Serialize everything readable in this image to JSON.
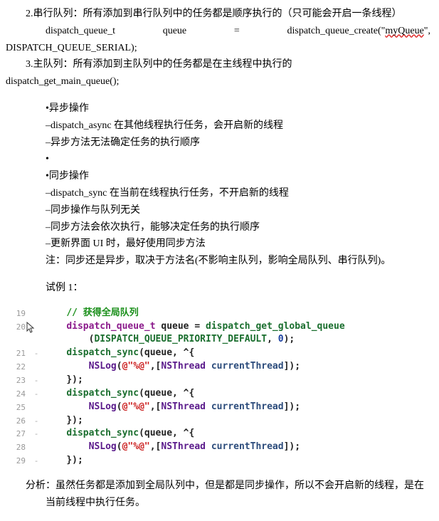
{
  "intro": {
    "item2_label": "2.串行队列：所有添加到串行队列中的任务都是顺序执行的（只可能会开启一条线程）",
    "item2_code_left": "dispatch_queue_t",
    "item2_code_mid": "queue",
    "item2_code_eq": "=",
    "item2_code_right_a": "dispatch_queue_create(\"",
    "item2_code_right_b": "myQueue",
    "item2_code_right_c": "\",",
    "item2_code_line2": "DISPATCH_QUEUE_SERIAL);",
    "item3_label": "3.主队列：所有添加到主队列中的任务都是在主线程中执行的",
    "item3_code": "dispatch_get_main_queue();"
  },
  "bullets": {
    "b1": "•异步操作",
    "b2": "–dispatch_async 在其他线程执行任务，会开启新的线程",
    "b3": "–异步方法无法确定任务的执行顺序",
    "b4": "•",
    "b5": "•同步操作",
    "b6": "–dispatch_sync 在当前在线程执行任务，不开启新的线程",
    "b7": "–同步操作与队列无关",
    "b8": "–同步方法会依次执行，能够决定任务的执行顺序",
    "b9": "–更新界面 UI 时，最好使用同步方法",
    "note": "注：同步还是异步，取决于方法名(不影响主队列，影响全局队列、串行队列)。"
  },
  "example_label": "试例 1：",
  "code": {
    "lines": [
      {
        "n": "19",
        "m": "",
        "indent": "    ",
        "parts": [
          {
            "cls": "tok-comment",
            "t": "// 获得全局队列"
          }
        ]
      },
      {
        "n": "20",
        "m": "",
        "indent": "    ",
        "cursor": true,
        "parts": [
          {
            "cls": "tok-type",
            "t": "dispatch_queue_t"
          },
          {
            "cls": "tok-plain",
            "t": " queue = "
          },
          {
            "cls": "tok-ident",
            "t": "dispatch_get_global_queue"
          }
        ]
      },
      {
        "n": "",
        "m": "",
        "indent": "        ",
        "parts": [
          {
            "cls": "tok-plain",
            "t": "("
          },
          {
            "cls": "tok-green",
            "t": "DISPATCH_QUEUE_PRIORITY_DEFAULT"
          },
          {
            "cls": "tok-plain",
            "t": ", "
          },
          {
            "cls": "tok-const",
            "t": "0"
          },
          {
            "cls": "tok-plain",
            "t": ");"
          }
        ]
      },
      {
        "n": "21",
        "m": "-",
        "indent": "    ",
        "parts": [
          {
            "cls": "tok-ident",
            "t": "dispatch_sync"
          },
          {
            "cls": "tok-plain",
            "t": "(queue, ^{"
          }
        ]
      },
      {
        "n": "22",
        "m": "",
        "indent": "        ",
        "parts": [
          {
            "cls": "tok-cls",
            "t": "NSLog"
          },
          {
            "cls": "tok-plain",
            "t": "("
          },
          {
            "cls": "tok-str",
            "t": "@\"%@\""
          },
          {
            "cls": "tok-plain",
            "t": ",["
          },
          {
            "cls": "tok-cls",
            "t": "NSThread"
          },
          {
            "cls": "tok-plain",
            "t": " "
          },
          {
            "cls": "tok-msg",
            "t": "currentThread"
          },
          {
            "cls": "tok-plain",
            "t": "]);"
          }
        ]
      },
      {
        "n": "23",
        "m": "-",
        "indent": "    ",
        "parts": [
          {
            "cls": "tok-plain",
            "t": "});"
          }
        ]
      },
      {
        "n": "24",
        "m": "-",
        "indent": "    ",
        "parts": [
          {
            "cls": "tok-ident",
            "t": "dispatch_sync"
          },
          {
            "cls": "tok-plain",
            "t": "(queue, ^{"
          }
        ]
      },
      {
        "n": "25",
        "m": "",
        "indent": "        ",
        "parts": [
          {
            "cls": "tok-cls",
            "t": "NSLog"
          },
          {
            "cls": "tok-plain",
            "t": "("
          },
          {
            "cls": "tok-str",
            "t": "@\"%@\""
          },
          {
            "cls": "tok-plain",
            "t": ",["
          },
          {
            "cls": "tok-cls",
            "t": "NSThread"
          },
          {
            "cls": "tok-plain",
            "t": " "
          },
          {
            "cls": "tok-msg",
            "t": "currentThread"
          },
          {
            "cls": "tok-plain",
            "t": "]);"
          }
        ]
      },
      {
        "n": "26",
        "m": "-",
        "indent": "    ",
        "parts": [
          {
            "cls": "tok-plain",
            "t": "});"
          }
        ]
      },
      {
        "n": "27",
        "m": "-",
        "indent": "    ",
        "parts": [
          {
            "cls": "tok-ident",
            "t": "dispatch_sync"
          },
          {
            "cls": "tok-plain",
            "t": "(queue, ^{"
          }
        ]
      },
      {
        "n": "28",
        "m": "",
        "indent": "        ",
        "parts": [
          {
            "cls": "tok-cls",
            "t": "NSLog"
          },
          {
            "cls": "tok-plain",
            "t": "("
          },
          {
            "cls": "tok-str",
            "t": "@\"%@\""
          },
          {
            "cls": "tok-plain",
            "t": ",["
          },
          {
            "cls": "tok-cls",
            "t": "NSThread"
          },
          {
            "cls": "tok-plain",
            "t": " "
          },
          {
            "cls": "tok-msg",
            "t": "currentThread"
          },
          {
            "cls": "tok-plain",
            "t": "]);"
          }
        ]
      },
      {
        "n": "29",
        "m": "-",
        "indent": "    ",
        "parts": [
          {
            "cls": "tok-plain",
            "t": "});"
          }
        ]
      }
    ]
  },
  "analysis": "分析：虽然任务都是添加到全局队列中，但是都是同步操作，所以不会开启新的线程，是在当前线程中执行任务。"
}
